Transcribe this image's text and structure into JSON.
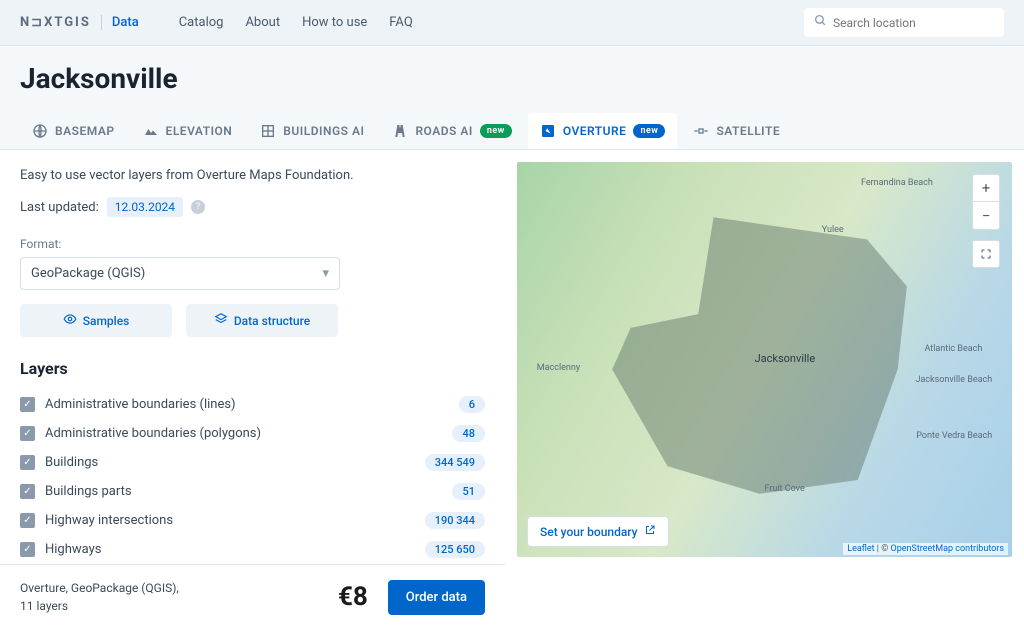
{
  "brand": {
    "name": "N⊐XTGIS",
    "section": "Data"
  },
  "nav": [
    "Catalog",
    "About",
    "How to use",
    "FAQ"
  ],
  "search": {
    "placeholder": "Search location"
  },
  "page_title": "Jacksonville",
  "tabs": [
    {
      "label": "BASEMAP"
    },
    {
      "label": "ELEVATION"
    },
    {
      "label": "BUILDINGS AI"
    },
    {
      "label": "ROADS AI",
      "badge": "new",
      "badge_color": "green"
    },
    {
      "label": "OVERTURE",
      "badge": "new",
      "badge_color": "blue",
      "active": true
    },
    {
      "label": "SATELLITE"
    }
  ],
  "description": "Easy to use vector layers from Overture Maps Foundation.",
  "updated": {
    "label": "Last updated:",
    "date": "12.03.2024"
  },
  "format": {
    "label": "Format:",
    "value": "GeoPackage (QGIS)"
  },
  "actions": {
    "samples": "Samples",
    "structure": "Data structure"
  },
  "layers_title": "Layers",
  "layers": [
    {
      "name": "Administrative boundaries (lines)",
      "count": "6"
    },
    {
      "name": "Administrative boundaries (polygons)",
      "count": "48"
    },
    {
      "name": "Buildings",
      "count": "344 549"
    },
    {
      "name": "Buildings parts",
      "count": "51"
    },
    {
      "name": "Highway intersections",
      "count": "190 344"
    },
    {
      "name": "Highways",
      "count": "125 650"
    }
  ],
  "footer": {
    "line1": "Overture, GeoPackage (QGIS),",
    "line2": "11 layers",
    "price": "€8",
    "order": "Order data"
  },
  "map": {
    "city": "Jacksonville",
    "boundary_btn": "Set your boundary",
    "attrib_leaflet": "Leaflet",
    "attrib_osm": "OpenStreetMap contributors",
    "labels": {
      "fernandina": "Fernandina Beach",
      "yulee": "Yulee",
      "atlantic": "Atlantic Beach",
      "jaxbeach": "Jacksonville Beach",
      "ponte": "Ponte Vedra Beach",
      "fruitcove": "Fruit Cove",
      "macclenny": "Macclenny"
    }
  }
}
